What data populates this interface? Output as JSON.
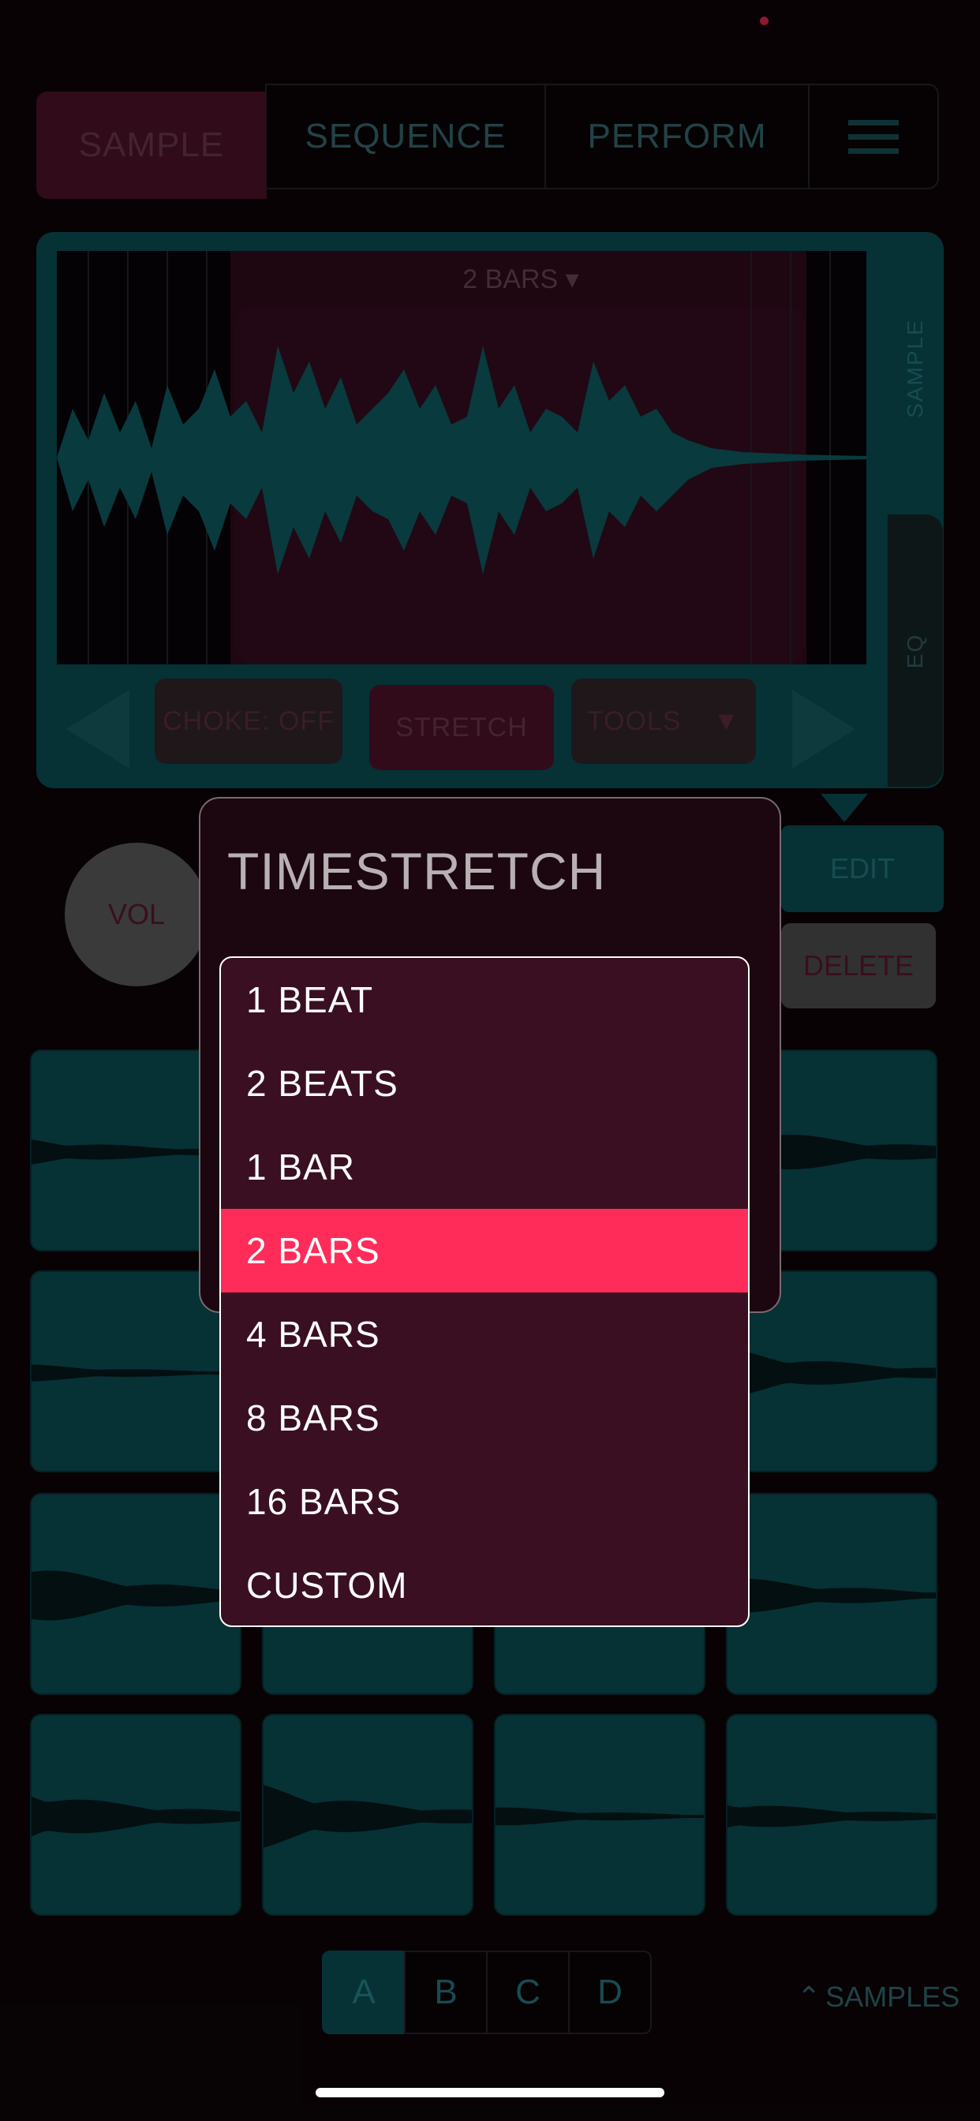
{
  "tabs": {
    "sample": "SAMPLE",
    "sequence": "SEQUENCE",
    "perform": "PERFORM"
  },
  "editor": {
    "length_label": "2 BARS",
    "choke_label": "CHOKE: OFF",
    "stretch_label": "STRETCH",
    "tools_label": "TOOLS",
    "side_sample": "SAMPLE",
    "side_eq": "EQ"
  },
  "controls": {
    "vol_label": "VOL",
    "edit_label": "EDIT",
    "delete_label": "DELETE"
  },
  "modal": {
    "title": "TIMESTRETCH",
    "options": [
      "1 BEAT",
      "2 BEATS",
      "1 BAR",
      "2 BARS",
      "4 BARS",
      "8 BARS",
      "16 BARS",
      "CUSTOM"
    ],
    "selected": "2 BARS"
  },
  "banks": [
    "A",
    "B",
    "C",
    "D"
  ],
  "active_bank": "A",
  "samples_link": "SAMPLES",
  "colors": {
    "accent": "#ff2c5a",
    "teal": "#0c5a61",
    "background": "#0f050a"
  }
}
